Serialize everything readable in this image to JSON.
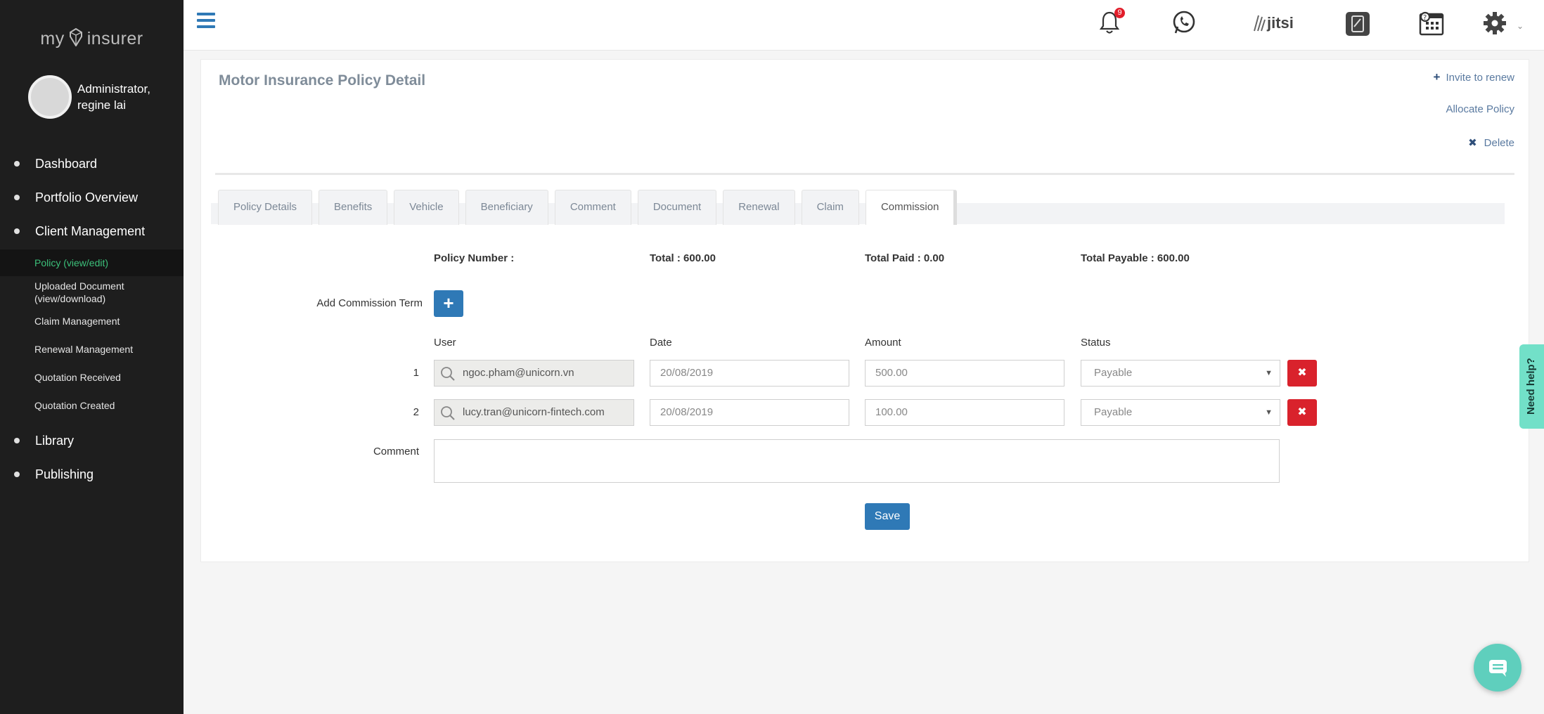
{
  "brand": {
    "logo_left": "my",
    "logo_right": "insurer"
  },
  "user": {
    "name": "Administrator, regine lai"
  },
  "sidebar": {
    "items": [
      {
        "label": "Dashboard"
      },
      {
        "label": "Portfolio Overview"
      },
      {
        "label": "Client Management"
      }
    ],
    "sub_items": [
      {
        "label": "Policy (view/edit)"
      },
      {
        "label": "Uploaded Document (view/download)"
      },
      {
        "label": "Claim Management"
      },
      {
        "label": "Renewal Management"
      },
      {
        "label": "Quotation Received"
      },
      {
        "label": "Quotation Created"
      }
    ],
    "bottom_items": [
      {
        "label": "Library"
      },
      {
        "label": "Publishing"
      }
    ]
  },
  "header": {
    "notification_count": "9",
    "jitsi_label": "jitsi"
  },
  "page": {
    "title": "Motor Insurance Policy Detail",
    "actions": {
      "invite": "Invite to renew",
      "allocate": "Allocate Policy",
      "delete": "Delete"
    },
    "tabs": [
      {
        "label": "Policy Details"
      },
      {
        "label": "Benefits"
      },
      {
        "label": "Vehicle"
      },
      {
        "label": "Beneficiary"
      },
      {
        "label": "Comment"
      },
      {
        "label": "Document"
      },
      {
        "label": "Renewal"
      },
      {
        "label": "Claim"
      },
      {
        "label": "Commission"
      }
    ]
  },
  "commission": {
    "policy_number": "Policy Number :",
    "total": "Total : 600.00",
    "total_paid": "Total Paid : 0.00",
    "total_payable": "Total Payable : 600.00",
    "add_term_label": "Add Commission Term",
    "add_button": "+",
    "columns": {
      "user": "User",
      "date": "Date",
      "amount": "Amount",
      "status": "Status"
    },
    "rows": [
      {
        "index": "1",
        "user": "ngoc.pham@unicorn.vn",
        "date": "20/08/2019",
        "amount": "500.00",
        "status": "Payable"
      },
      {
        "index": "2",
        "user": "lucy.tran@unicorn-fintech.com",
        "date": "20/08/2019",
        "amount": "100.00",
        "status": "Payable"
      }
    ],
    "comment_label": "Comment",
    "comment_value": "",
    "save_label": "Save"
  },
  "help": {
    "label": "Need help?"
  },
  "colors": {
    "primary": "#2f79b6",
    "danger": "#d9222c",
    "sidebar_bg": "#1e1e1e",
    "active_green": "#3cc07a",
    "help_bg": "#72e0c8"
  }
}
